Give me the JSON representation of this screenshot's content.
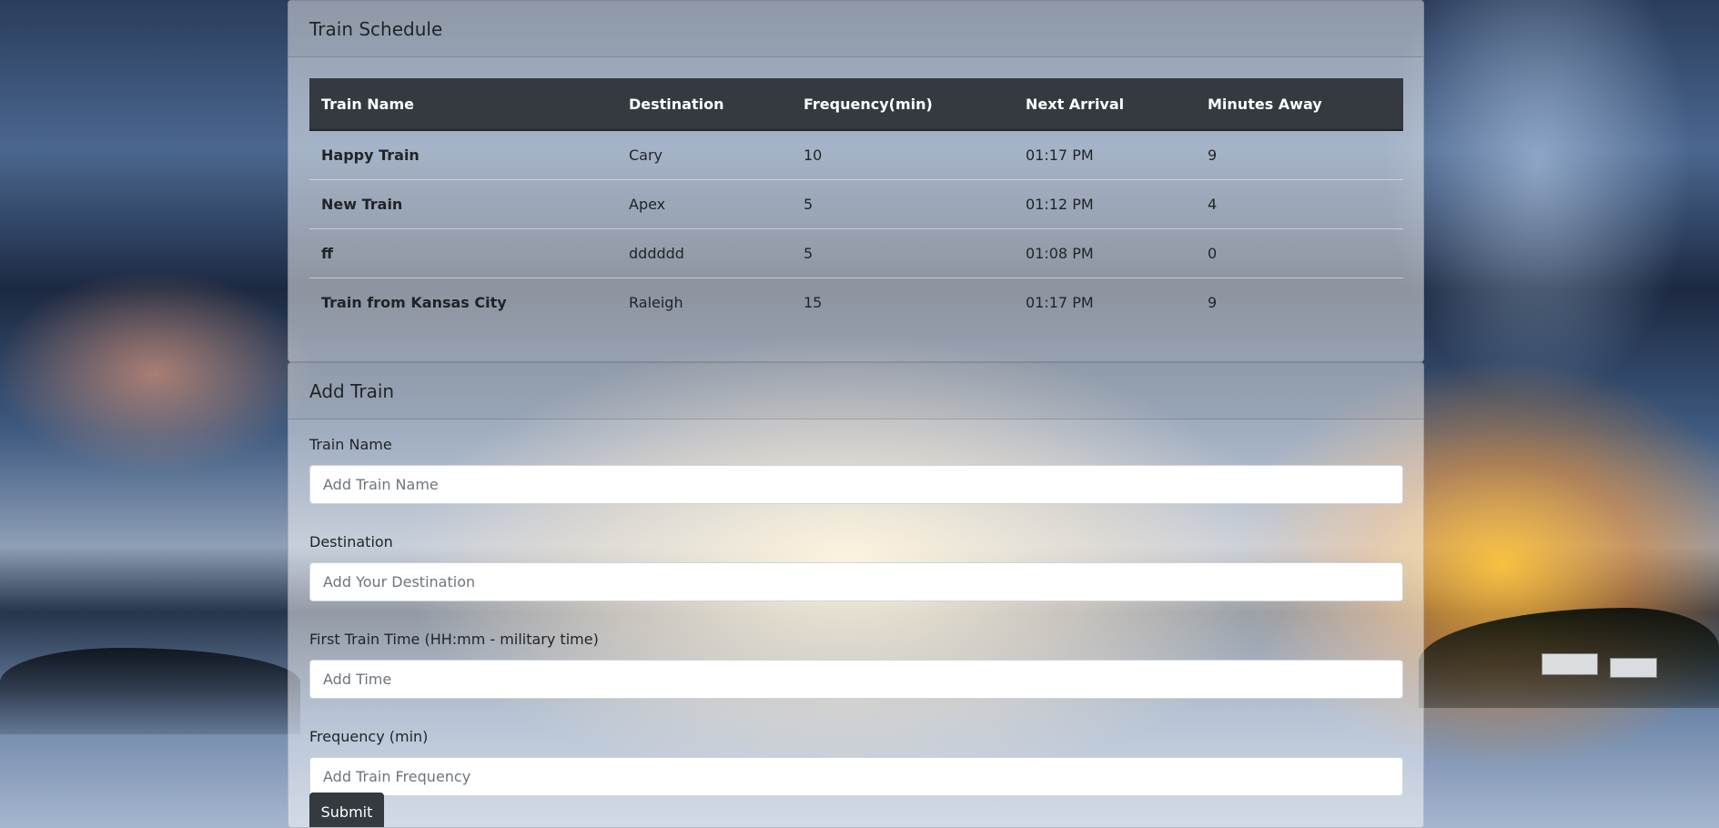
{
  "schedule": {
    "title": "Train Schedule",
    "columns": [
      "Train Name",
      "Destination",
      "Frequency(min)",
      "Next Arrival",
      "Minutes Away"
    ],
    "rows": [
      [
        "Happy Train",
        "Cary",
        "10",
        "01:17 PM",
        "9"
      ],
      [
        "New Train",
        "Apex",
        "5",
        "01:12 PM",
        "4"
      ],
      [
        "ff",
        "dddddd",
        "5",
        "01:08 PM",
        "0"
      ],
      [
        "Train from Kansas City",
        "Raleigh",
        "15",
        "01:17 PM",
        "9"
      ]
    ]
  },
  "add_train": {
    "title": "Add Train",
    "fields": [
      {
        "label": "Train Name",
        "placeholder": "Add Train Name",
        "value": ""
      },
      {
        "label": "Destination",
        "placeholder": "Add Your Destination",
        "value": ""
      },
      {
        "label": "First Train Time (HH:mm - military time)",
        "placeholder": "Add Time",
        "value": ""
      },
      {
        "label": "Frequency (min)",
        "placeholder": "Add Train Frequency",
        "value": ""
      }
    ],
    "submit_label": "Submit"
  },
  "colors": {
    "table_header_bg": "#343a40",
    "button_bg": "#343a40",
    "card_bg": "rgba(255,255,255,0.5)"
  }
}
